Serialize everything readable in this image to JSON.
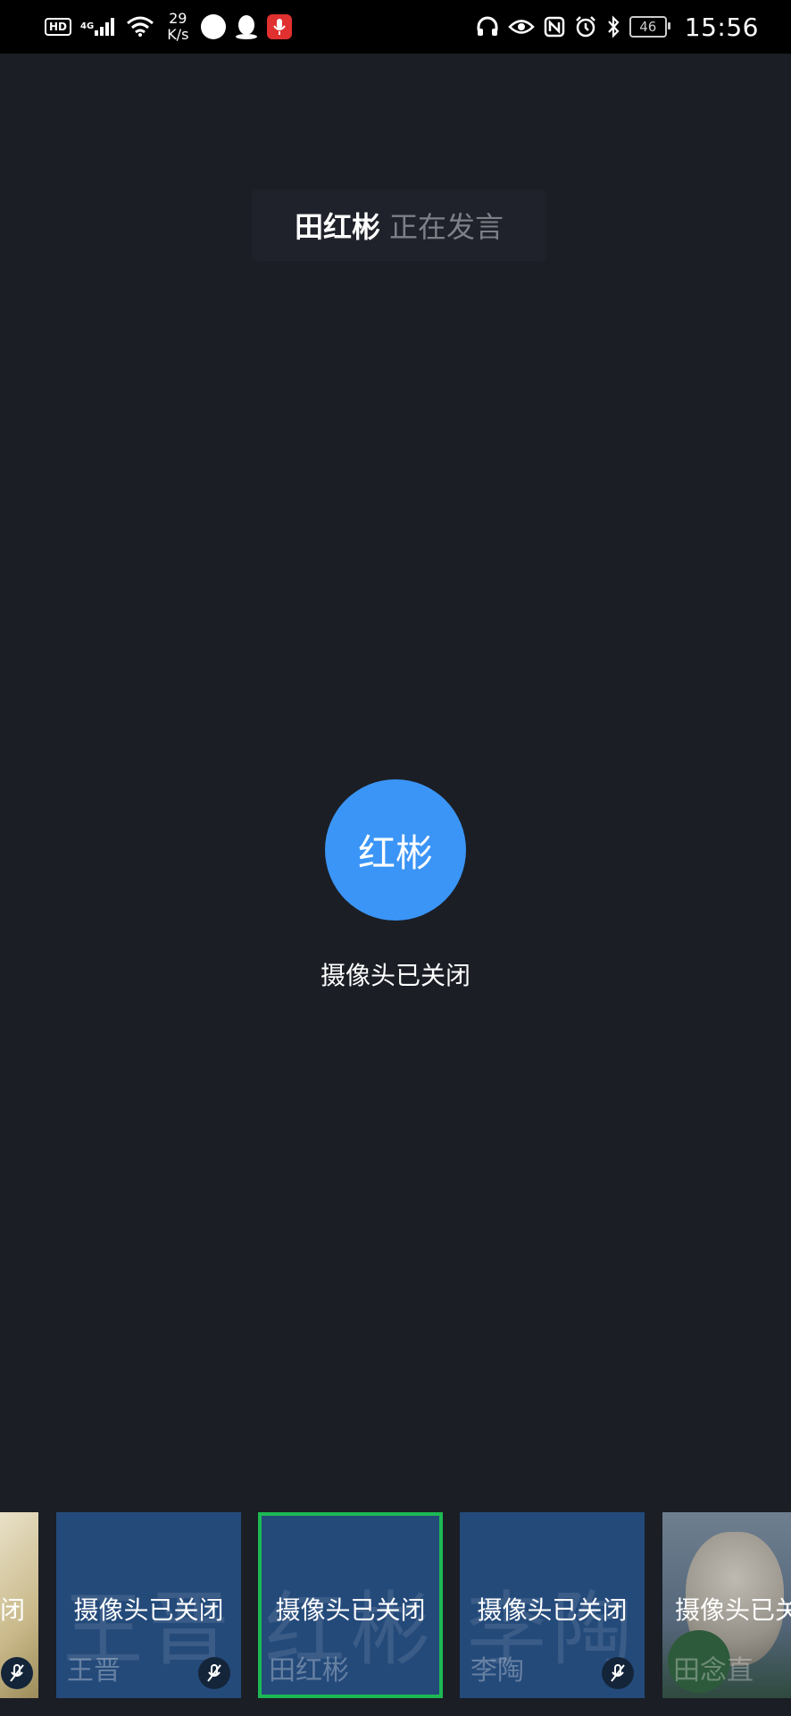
{
  "status_bar": {
    "hd": "HD",
    "network": "4G",
    "speed_value": "29",
    "speed_unit": "K/s",
    "battery": "46",
    "time": "15:56"
  },
  "speaker_banner": {
    "name": "田红彬",
    "status": "正在发言"
  },
  "main": {
    "avatar_text": "红彬",
    "camera_off_text": "摄像头已关闭",
    "avatar_color": "#3b95f6"
  },
  "thumbnails": [
    {
      "camera_off_text": "闭",
      "muted": true
    },
    {
      "watermark": "王晋",
      "camera_off_text": "摄像头已关闭",
      "name": "王晋",
      "muted": true
    },
    {
      "watermark": "红彬",
      "camera_off_text": "摄像头已关闭",
      "name": "田红彬",
      "muted": false,
      "selected": true
    },
    {
      "watermark": "李陶",
      "camera_off_text": "摄像头已关闭",
      "name": "李陶",
      "muted": true
    },
    {
      "camera_off_text": "摄像头已关闭",
      "name": "田念直",
      "muted": false
    }
  ],
  "colors": {
    "background": "#1b1e25",
    "tile": "#244a7a",
    "selected_border": "#1db955",
    "speaking_status": "#7e8088"
  }
}
